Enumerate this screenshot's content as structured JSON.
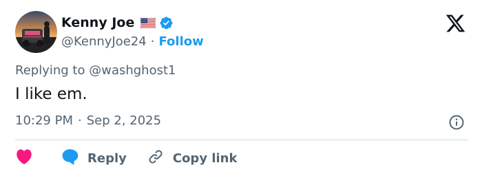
{
  "author": {
    "display_name": "Kenny Joe",
    "handle": "@KennyJoe24",
    "flag": "us-flag-icon",
    "verified": true,
    "follow_label": "Follow",
    "separator": "·"
  },
  "tweet": {
    "replying_prefix": "Replying to",
    "replying_to": "@washghost1",
    "text": "I like em.",
    "time": "10:29 PM",
    "date_separator": "·",
    "date": "Sep 2, 2025"
  },
  "actions": {
    "like_icon": "heart-icon",
    "reply_label": "Reply",
    "copy_label": "Copy link"
  },
  "colors": {
    "accent": "#1d9bf0",
    "text_primary": "#0f1419",
    "text_secondary": "#536471",
    "like": "#f91880",
    "divider": "#cfd9de"
  }
}
